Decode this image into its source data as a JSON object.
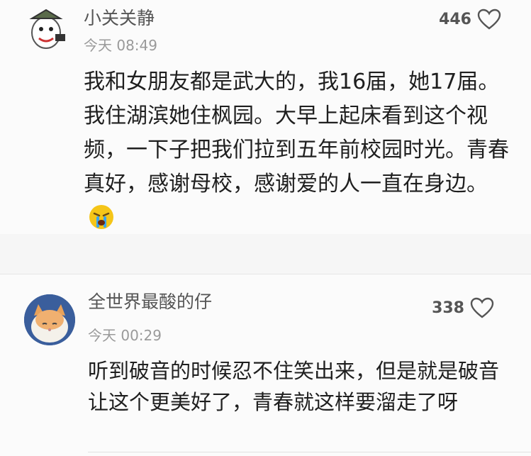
{
  "comments": [
    {
      "username": "小关关静",
      "time": "今天 08:49",
      "likes": "446",
      "text": "我和女朋友都是武大的，我16届，她17届。我住湖滨她住枫园。大早上起床看到这个视频，一下子把我们拉到五年前校园时光。青春真好，感谢母校，感谢爱的人一直在身边。",
      "emoji": "crying-face-icon"
    },
    {
      "username": "全世界最酸的仔",
      "time": "今天 00:29",
      "likes": "338",
      "text": "听到破音的时候忍不住笑出来，但是就是破音让这个更美好了，青春就这样要溜走了呀"
    }
  ],
  "colors": {
    "like": "#555555",
    "emoji": "#f5c518"
  }
}
